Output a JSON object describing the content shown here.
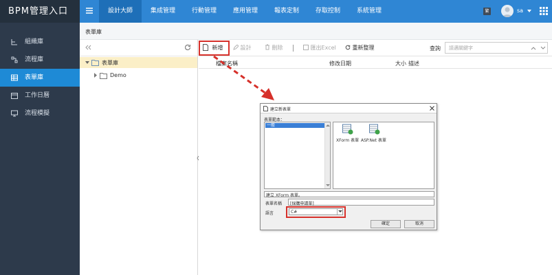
{
  "app": {
    "brand": "BPM管理入口"
  },
  "sidebar": {
    "items": [
      {
        "label": "組織庫",
        "icon": "org-icon"
      },
      {
        "label": "流程庫",
        "icon": "flow-icon"
      },
      {
        "label": "表單庫",
        "icon": "form-icon"
      },
      {
        "label": "工作日曆",
        "icon": "calendar-icon"
      },
      {
        "label": "流程模擬",
        "icon": "monitor-icon"
      }
    ],
    "active_index": 2
  },
  "topnav": {
    "tabs": [
      "設計大師",
      "集成管理",
      "行動管理",
      "應用管理",
      "報表定制",
      "存取控制",
      "系統管理"
    ],
    "active_index": 0,
    "badge": "繁",
    "user": "sa"
  },
  "breadcrumb": "表單庫",
  "tree": {
    "root": "表單庫",
    "child": "Demo"
  },
  "toolbar": {
    "new": "新增",
    "design": "設計",
    "delete": "刪除",
    "export": "匯出Excel",
    "refresh": "重新整理",
    "query_label": "查詢",
    "search_placeholder": "請邁關鍵字"
  },
  "table": {
    "columns": [
      "檔案名稱",
      "修改日期",
      "大小",
      "描述"
    ]
  },
  "dialog": {
    "title": "建立新表單",
    "template_label": "表單範本：",
    "template_selected": "一般",
    "templates": [
      "XForm 表單",
      "ASP.Net 表單"
    ],
    "status_text": "建立 XForm 表單。",
    "name_label": "表單名稱",
    "name_value": "[採購申請單]",
    "lang_label": "語言",
    "lang_value": "C#",
    "ok": "確定",
    "cancel": "取消"
  },
  "colors": {
    "accent": "#2f86d4",
    "sidebar": "#2d3a4b",
    "highlight": "#d6302a"
  }
}
